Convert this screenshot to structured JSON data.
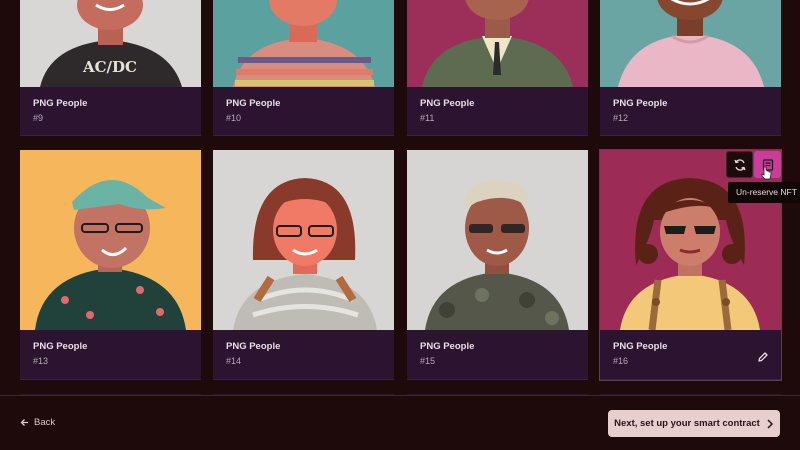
{
  "collection_name": "PNG People",
  "cards": [
    {
      "number": "#9"
    },
    {
      "number": "#10"
    },
    {
      "number": "#11"
    },
    {
      "number": "#12"
    },
    {
      "number": "#13"
    },
    {
      "number": "#14"
    },
    {
      "number": "#15"
    },
    {
      "number": "#16"
    }
  ],
  "tooltip": "Un-reserve NFT",
  "footer": {
    "back_label": "Back",
    "next_label": "Next, set up your smart contract"
  },
  "colors": {
    "page_bg": "#1e0a0a",
    "card_info_bg": "#2c1430",
    "accent_magenta": "#c93e98",
    "next_button_bg": "#e8cfcf"
  },
  "icons": [
    "refresh-icon",
    "unreserve-icon",
    "edit-pencil-icon",
    "arrow-left-icon",
    "chevron-right-icon",
    "cursor-icon"
  ]
}
